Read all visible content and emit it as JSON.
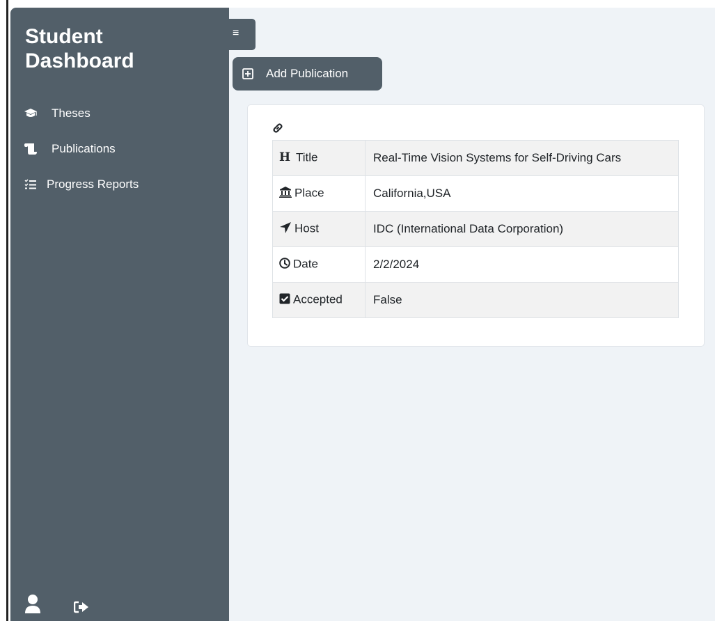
{
  "sidebar": {
    "brand": "Student Dashboard",
    "items": [
      {
        "label": "Theses",
        "icon": "graduation-cap-icon"
      },
      {
        "label": "Publications",
        "icon": "scroll-icon"
      },
      {
        "label": "Progress Reports",
        "icon": "list-check-icon"
      }
    ],
    "footer": {
      "profile_icon": "user-icon",
      "logout_icon": "sign-out-icon"
    }
  },
  "toolbar": {
    "toggle_label": "≡",
    "add_publication_label": "Add Publication"
  },
  "publication": {
    "rows": [
      {
        "label": "Title",
        "value": "Real-Time Vision Systems for Self-Driving Cars",
        "icon": "heading-icon"
      },
      {
        "label": "Place",
        "value": "California,USA",
        "icon": "building-columns-icon"
      },
      {
        "label": "Host",
        "value": "IDC (International Data Corporation)",
        "icon": "location-arrow-icon"
      },
      {
        "label": "Date",
        "value": "2/2/2024",
        "icon": "clock-icon"
      },
      {
        "label": "Accepted",
        "value": "False",
        "icon": "checkbox-icon"
      }
    ]
  },
  "colors": {
    "sidebar_bg": "#525f69",
    "main_bg": "#eff3f7",
    "table_stripe": "#f2f2f2"
  }
}
